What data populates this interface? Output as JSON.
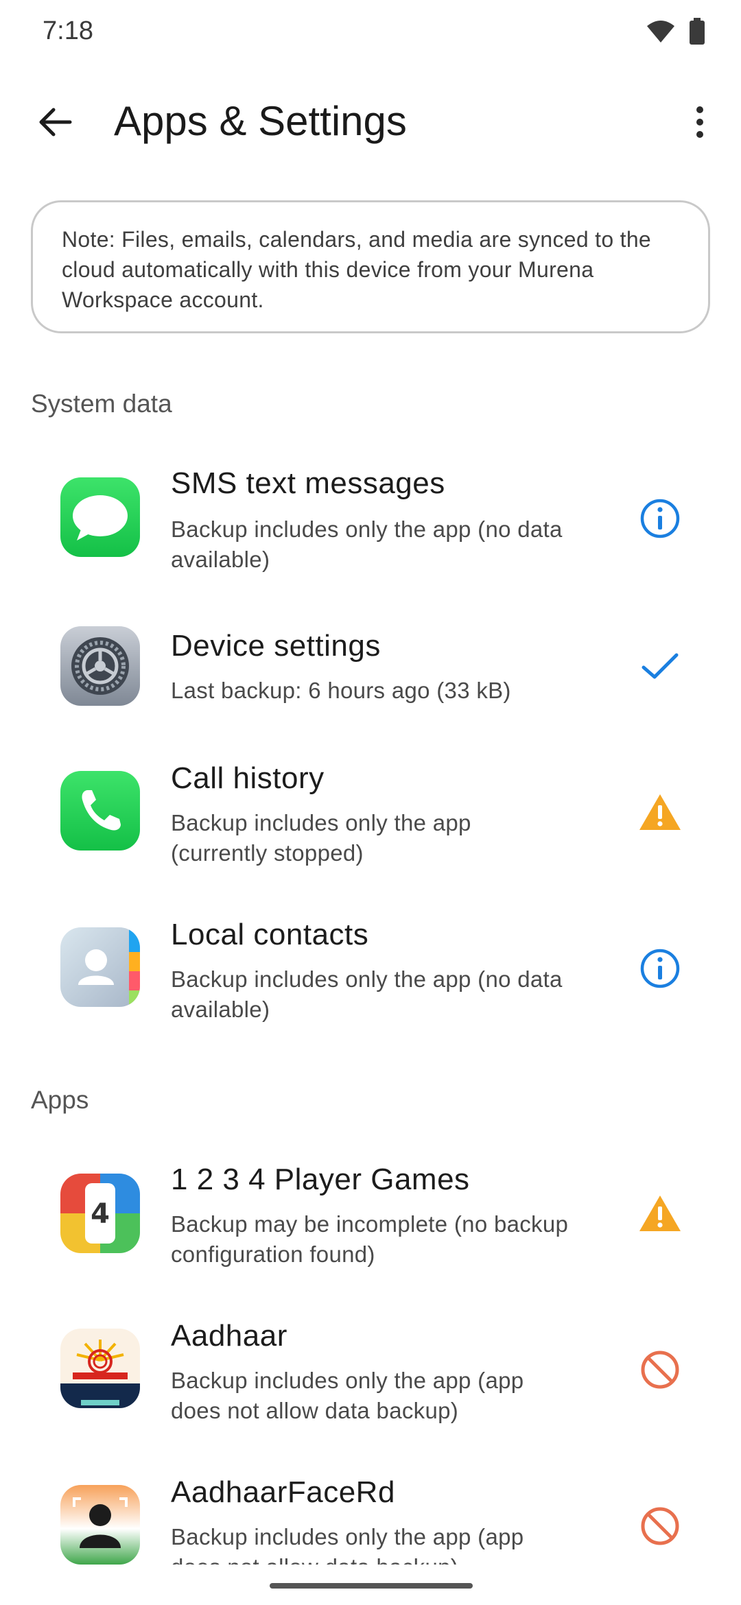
{
  "status_bar": {
    "time": "7:18"
  },
  "app_bar": {
    "title": "Apps & Settings"
  },
  "note": {
    "text": "Note: Files, emails, calendars, and media are synced to the cloud automatically with this device from your Murena Workspace account."
  },
  "sections": {
    "system_data": "System data",
    "apps": "Apps"
  },
  "system_items": [
    {
      "title": "SMS text messages",
      "subtitle": "Backup includes only the app (no data available)",
      "status": "info-icon"
    },
    {
      "title": "Device settings",
      "subtitle": "Last backup: 6 hours ago (33 kB)",
      "status": "check-icon"
    },
    {
      "title": "Call history",
      "subtitle": "Backup includes only the app (currently stopped)",
      "status": "warning-icon"
    },
    {
      "title": "Local contacts",
      "subtitle": "Backup includes only the app (no data available)",
      "status": "info-icon"
    }
  ],
  "app_items": [
    {
      "title": "1 2 3 4 Player Games",
      "subtitle": "Backup may be incomplete (no backup configuration found)",
      "status": "warning-icon"
    },
    {
      "title": "Aadhaar",
      "subtitle": "Backup includes only the app (app does not allow data backup)",
      "status": "blocked-icon"
    },
    {
      "title": "AadhaarFaceRd",
      "subtitle": "Backup includes only the app (app does not allow data backup)",
      "status": "blocked-icon"
    }
  ],
  "colors": {
    "info": "#1a7fe0",
    "warning": "#f5a623",
    "blocked": "#e8704e",
    "check": "#1a7fe0"
  }
}
